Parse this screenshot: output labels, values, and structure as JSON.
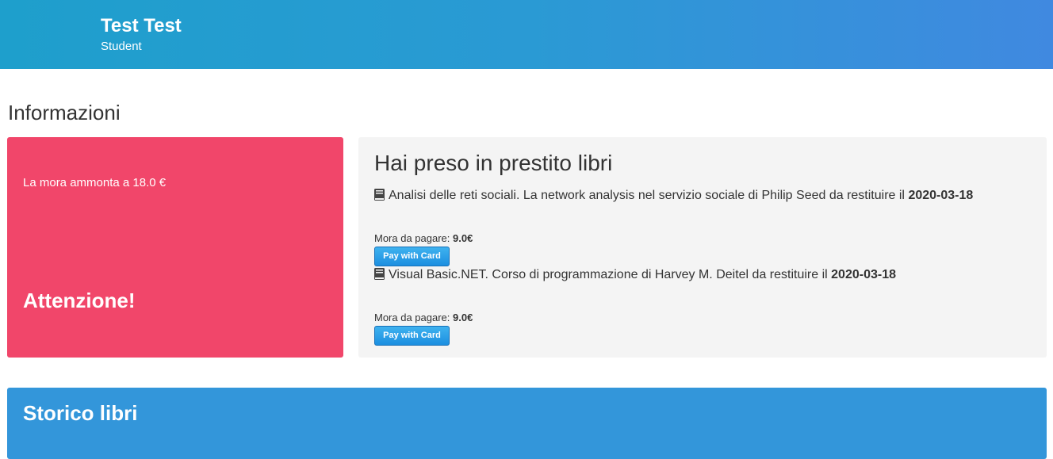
{
  "header": {
    "user_name": "Test Test",
    "user_role": "Student"
  },
  "section": {
    "title": "Informazioni"
  },
  "alert": {
    "title": "Attenzione!",
    "text": "La mora ammonta a 18.0 €",
    "color": "#f1466a"
  },
  "loans": {
    "title": "Hai preso in prestito libri",
    "items": [
      {
        "icon": "book-icon",
        "description": "Analisi delle reti sociali. La network analysis nel servizio sociale di Philip Seed da restituire il",
        "due_date": "2020-03-18",
        "fee_label": "Mora da pagare:",
        "fee_value": "9.0€",
        "pay_label": "Pay with Card"
      },
      {
        "icon": "book-icon",
        "description": "Visual Basic.NET. Corso di programmazione di Harvey M. Deitel da restituire il",
        "due_date": "2020-03-18",
        "fee_label": "Mora da pagare:",
        "fee_value": "9.0€",
        "pay_label": "Pay with Card"
      }
    ]
  },
  "history": {
    "title": "Storico libri",
    "color": "#3396da"
  }
}
